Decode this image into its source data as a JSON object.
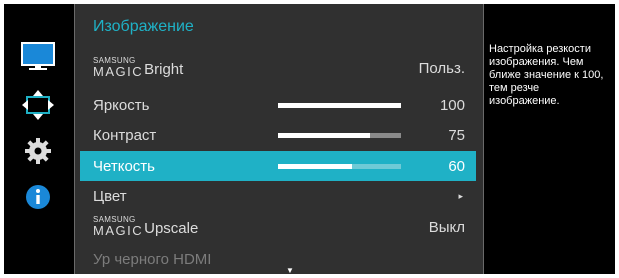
{
  "sidebar": {
    "icons": [
      {
        "name": "picture-icon",
        "active": false
      },
      {
        "name": "screen-adjust-icon",
        "active": true
      },
      {
        "name": "settings-icon",
        "active": false
      },
      {
        "name": "info-icon",
        "active": false
      }
    ]
  },
  "menu": {
    "title": "Изображение",
    "brand_small": "SAMSUNG",
    "brand_large": "MAGIC",
    "items": [
      {
        "label": "Bright",
        "value": "Польз."
      },
      {
        "label": "Яркость",
        "value": "100",
        "level": 100
      },
      {
        "label": "Контраст",
        "value": "75",
        "level": 75
      },
      {
        "label": "Четкость",
        "value": "60",
        "level": 60,
        "selected": true
      },
      {
        "label": "Цвет",
        "arrow": "▸"
      },
      {
        "label": "Upscale",
        "value": "Выкл"
      },
      {
        "label": "Ур черного HDMI",
        "disabled": true
      }
    ],
    "scroll_indicator": "▼"
  },
  "help": {
    "text": "Настройка резкости изображения. Чем ближе значение к 100, тем резче изображение."
  },
  "colors": {
    "accent": "#1fb1c6",
    "panel_bg": "#303030",
    "rail_bg": "#000000"
  }
}
